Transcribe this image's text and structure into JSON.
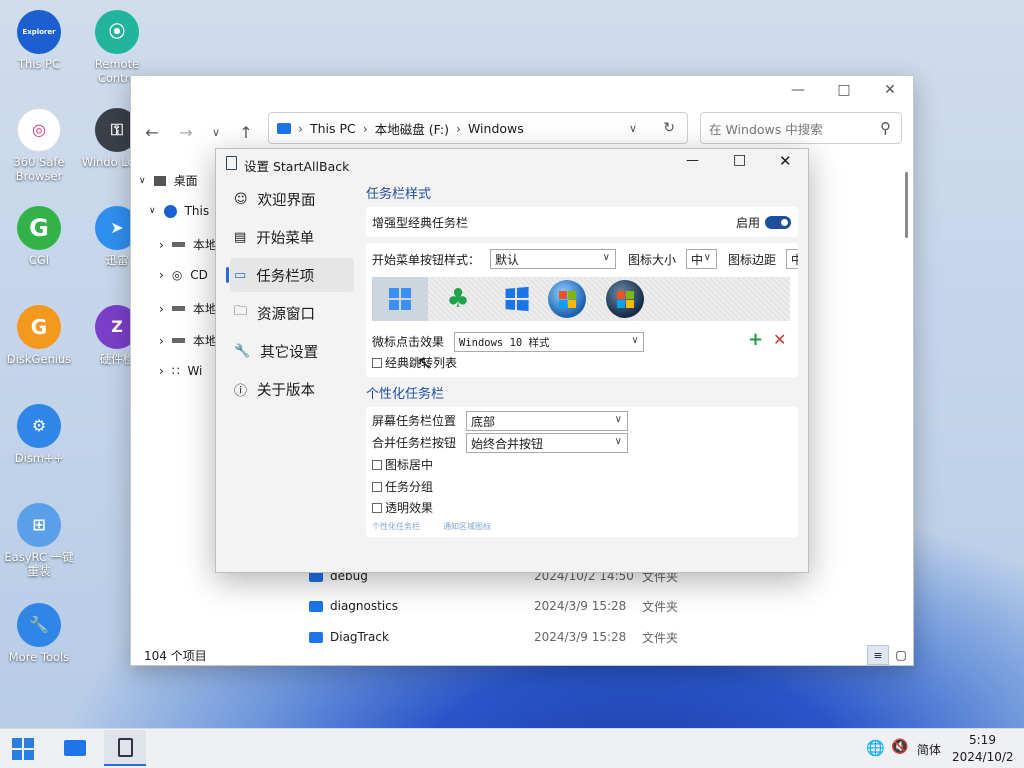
{
  "desktop_icons": [
    {
      "label": "This PC",
      "sub": "Explorer",
      "color": "#1c5fd1"
    },
    {
      "label": "Remote Contro",
      "color": "#20b59c"
    },
    {
      "label": "360 Safe Browser",
      "color": "#ffffff"
    },
    {
      "label": "Windo Login",
      "color": "#3a3f48"
    },
    {
      "label": "CGI",
      "glyph": "G",
      "color": "#33b24a"
    },
    {
      "label": "迅雷",
      "color": "#2f8ff0"
    },
    {
      "label": "DiskGenius",
      "glyph": "G",
      "color": "#f39a1e"
    },
    {
      "label": "硬件检",
      "glyph": "Z",
      "color": "#7b3fc9"
    },
    {
      "label": "Dism++",
      "color": "#2f86e6"
    },
    {
      "label": "EasyRC 一键重装",
      "color": "#5aa0e8"
    },
    {
      "label": "More Tools",
      "color": "#2f86e6"
    }
  ],
  "explorer": {
    "address": [
      "This PC",
      "本地磁盘 (F:)",
      "Windows"
    ],
    "search_placeholder": "在 Windows 中搜索",
    "tree": [
      "桌面",
      "This",
      "本地",
      "CD",
      "本地",
      "本地",
      "Wi"
    ],
    "files": [
      {
        "name": "debug",
        "date": "2024/10/2 14:50",
        "type": "文件夹"
      },
      {
        "name": "diagnostics",
        "date": "2024/3/9 15:28",
        "type": "文件夹"
      },
      {
        "name": "DiagTrack",
        "date": "2024/3/9 15:28",
        "type": "文件夹"
      }
    ],
    "status": "104 个项目"
  },
  "settings": {
    "title": "设置 StartAllBack",
    "nav": [
      "欢迎界面",
      "开始菜单",
      "任务栏项",
      "资源窗口",
      "其它设置",
      "关于版本"
    ],
    "active_nav": 2,
    "section1_title": "任务栏样式",
    "enhanced_label": "增强型经典任务栏",
    "enabled_label": "启用",
    "start_style_label": "开始菜单按钮样式：",
    "start_style_value": "默认",
    "icon_size_label": "图标大小",
    "icon_size_value": "中",
    "icon_margin_label": "图标边距",
    "icon_margin_value": "中",
    "click_effect_label": "微标点击效果",
    "click_effect_value": "Windows 10 样式",
    "jumplist_label": "经典跳转列表",
    "section2_title": "个性化任务栏",
    "position_label": "屏幕任务栏位置",
    "position_value": "底部",
    "combine_label": "合并任务栏按钮",
    "combine_value": "始终合并按钮",
    "center_label": "图标居中",
    "group_label": "任务分组",
    "transparent_label": "透明效果",
    "link1": "个性化任务栏",
    "link2": "通知区域图标"
  },
  "taskbar": {
    "ime": "简体",
    "time": "5:19",
    "date": "2024/10/2"
  },
  "colors": {
    "accent": "#2a6bd6",
    "toggle": "#1e4f9c",
    "folder": "#1e74e8"
  }
}
